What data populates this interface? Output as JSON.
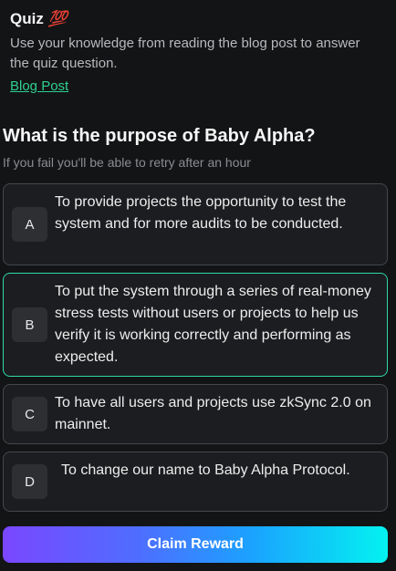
{
  "quiz": {
    "title": "Quiz",
    "title_emoji": "💯",
    "intro": "Use your knowledge from reading the blog post to answer the quiz question.",
    "blog_link": "Blog Post"
  },
  "question": {
    "text": "What is the purpose of Baby Alpha?",
    "retry_note": "If you fail you'll be able to retry after an hour"
  },
  "options": [
    {
      "letter": "A",
      "text": "To provide projects the opportunity to test the system and for more audits to be conducted.",
      "selected": false
    },
    {
      "letter": "B",
      "text": "To put the system through a series of real-money stress tests without users or projects to help us verify it is working correctly and performing as expected.",
      "selected": true
    },
    {
      "letter": "C",
      "text": "To have all users and projects use zkSync 2.0 on mainnet.",
      "selected": false
    },
    {
      "letter": "D",
      "text": "To change our name to Baby Alpha Protocol.",
      "selected": false
    }
  ],
  "actions": {
    "claim_label": "Claim Reward"
  },
  "colors": {
    "background": "#131416",
    "accent_green": "#2fd08f",
    "selected_border": "#2fd9a8",
    "button_gradient_start": "#7a47ff",
    "button_gradient_end": "#03f2f0"
  }
}
